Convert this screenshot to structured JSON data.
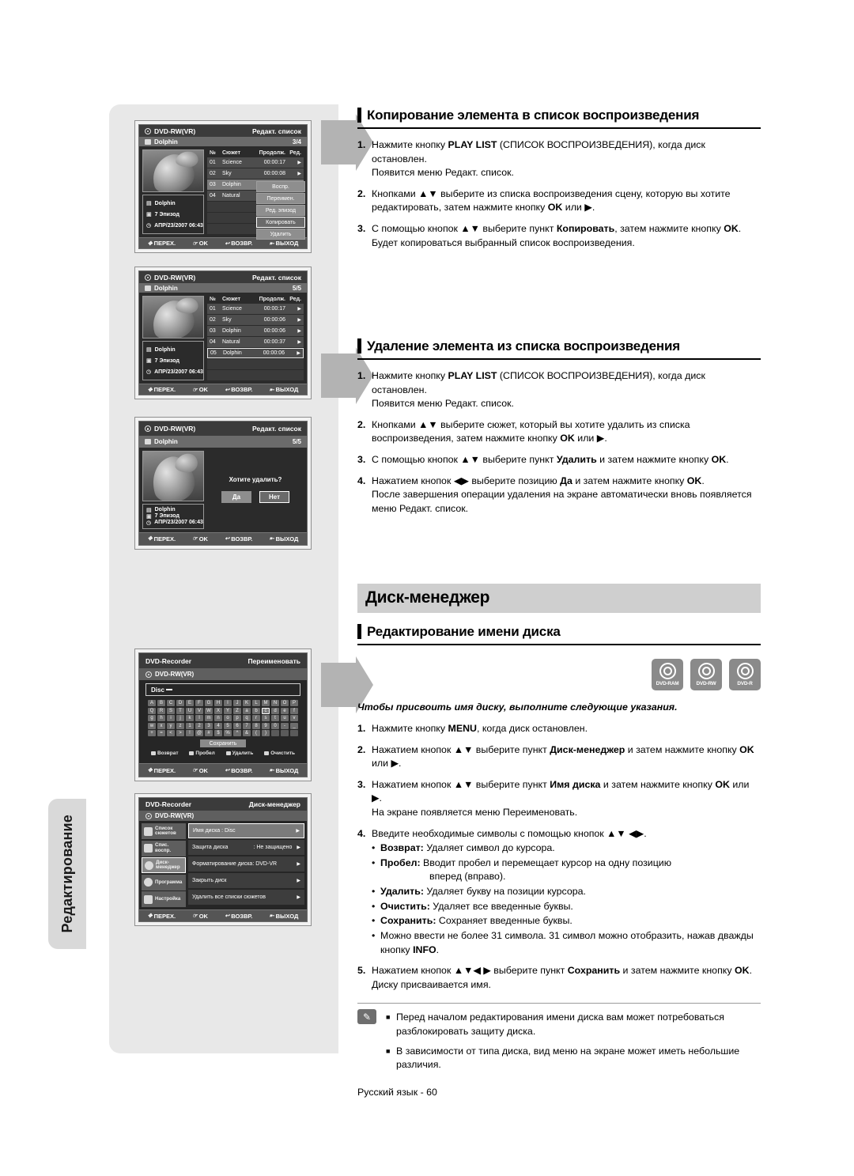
{
  "side_tab": {
    "label": "Редактирование"
  },
  "sections": {
    "copy": {
      "heading": "Копирование элемента в список воспроизведения",
      "steps": [
        {
          "num": "1.",
          "parts": [
            {
              "t": "Нажмите кнопку "
            },
            {
              "t": "PLAY LIST",
              "b": true
            },
            {
              "t": " (СПИСОК ВОСПРОИЗВЕДЕНИЯ), когда диск остановлен."
            },
            {
              "br": true
            },
            {
              "t": "Появится меню Редакт. список."
            }
          ]
        },
        {
          "num": "2.",
          "parts": [
            {
              "t": "Кнопками ▲▼ выберите из списка воспроизведения сцену, которую вы хотите редактировать, затем нажмите кнопку "
            },
            {
              "t": "OK",
              "b": true
            },
            {
              "t": " или ▶."
            }
          ]
        },
        {
          "num": "3.",
          "parts": [
            {
              "t": "С помощью кнопок ▲▼ выберите пункт "
            },
            {
              "t": "Копировать",
              "b": true
            },
            {
              "t": ", затем нажмите кнопку "
            },
            {
              "t": "OK",
              "b": true
            },
            {
              "t": "."
            },
            {
              "br": true
            },
            {
              "t": "Будет копироваться выбранный список воспроизведения."
            }
          ]
        }
      ]
    },
    "delete": {
      "heading": "Удаление элемента из списка воспроизведения",
      "steps": [
        {
          "num": "1.",
          "parts": [
            {
              "t": "Нажмите кнопку "
            },
            {
              "t": "PLAY LIST",
              "b": true
            },
            {
              "t": " (СПИСОК ВОСПРОИЗВЕДЕНИЯ), когда диск остановлен."
            },
            {
              "br": true
            },
            {
              "t": "Появится меню Редакт. список."
            }
          ]
        },
        {
          "num": "2.",
          "parts": [
            {
              "t": "Кнопками ▲▼ выберите сюжет, который вы хотите удалить из списка воспроизведения, затем нажмите кнопку "
            },
            {
              "t": "OK",
              "b": true
            },
            {
              "t": " или ▶."
            }
          ]
        },
        {
          "num": "3.",
          "parts": [
            {
              "t": "С помощью кнопок ▲▼ выберите пункт "
            },
            {
              "t": "Удалить",
              "b": true
            },
            {
              "t": " и затем нажмите кнопку "
            },
            {
              "t": "OK",
              "b": true
            },
            {
              "t": "."
            }
          ]
        },
        {
          "num": "4.",
          "parts": [
            {
              "t": "Нажатием кнопок ◀▶ выберите позицию "
            },
            {
              "t": "Да",
              "b": true
            },
            {
              "t": " и затем нажмите кнопку "
            },
            {
              "t": "OK",
              "b": true
            },
            {
              "t": "."
            },
            {
              "br": true
            },
            {
              "t": "После завершения операции удаления на экране автоматически вновь появляется меню Редакт. список."
            }
          ]
        }
      ]
    },
    "disc_manager": {
      "chapter_title": "Диск-менеджер",
      "heading": "Редактирование имени диска",
      "disc_marks": [
        "DVD-RAM",
        "DVD-RW",
        "DVD-R"
      ],
      "intro": "Чтобы присвоить имя диску, выполните следующие указания.",
      "steps": [
        {
          "num": "1.",
          "parts": [
            {
              "t": "Нажмите кнопку "
            },
            {
              "t": "MENU",
              "b": true
            },
            {
              "t": ", когда диск остановлен."
            }
          ]
        },
        {
          "num": "2.",
          "parts": [
            {
              "t": "Нажатием кнопок ▲▼ выберите пункт "
            },
            {
              "t": "Диск-менеджер",
              "b": true
            },
            {
              "t": " и затем нажмите кнопку "
            },
            {
              "t": "OK",
              "b": true
            },
            {
              "t": " или ▶."
            }
          ]
        },
        {
          "num": "3.",
          "parts": [
            {
              "t": "Нажатием кнопок ▲▼ выберите пункт "
            },
            {
              "t": "Имя диска",
              "b": true
            },
            {
              "t": " и затем нажмите кнопку "
            },
            {
              "t": "OK",
              "b": true
            },
            {
              "t": " или ▶."
            },
            {
              "br": true
            },
            {
              "t": "На экране появляется меню Переименовать."
            }
          ]
        },
        {
          "num": "4.",
          "parts": [
            {
              "t": "Введите необходимые символы с помощью кнопок ▲▼ ◀▶."
            }
          ],
          "sub": [
            {
              "bullet": "•",
              "parts": [
                {
                  "t": "Возврат:",
                  "b": true
                },
                {
                  "t": " Удаляет символ до курсора."
                }
              ]
            },
            {
              "bullet": "•",
              "parts": [
                {
                  "t": "Пробел:",
                  "b": true
                },
                {
                  "t": " Вводит пробел и перемещает курсор на одну позицию"
                },
                {
                  "hang": "вперед (вправо)."
                }
              ]
            },
            {
              "bullet": "•",
              "parts": [
                {
                  "t": "Удалить:",
                  "b": true
                },
                {
                  "t": " Удаляет букву на позиции курсора."
                }
              ]
            },
            {
              "bullet": "•",
              "parts": [
                {
                  "t": "Очистить:",
                  "b": true
                },
                {
                  "t": " Удаляет все введенные буквы."
                }
              ]
            },
            {
              "bullet": "•",
              "parts": [
                {
                  "t": "Сохранить:",
                  "b": true
                },
                {
                  "t": " Сохраняет введенные буквы."
                }
              ]
            },
            {
              "bullet": "•",
              "parts": [
                {
                  "t": "Можно ввести не более 31 символа. 31 символ можно отобразить, нажав дважды кнопку "
                },
                {
                  "t": "INFO",
                  "b": true
                },
                {
                  "t": "."
                }
              ]
            }
          ]
        },
        {
          "num": "5.",
          "parts": [
            {
              "t": "Нажатием кнопок ▲▼◀ ▶ выберите пункт "
            },
            {
              "t": "Сохранить",
              "b": true
            },
            {
              "t": " и затем нажмите кнопку "
            },
            {
              "t": "OK",
              "b": true
            },
            {
              "t": "."
            },
            {
              "br": true
            },
            {
              "t": "Диску присваивается имя."
            }
          ]
        }
      ],
      "notes": [
        "Перед началом редактирования имени диска вам может потребоваться разблокировать защиту диска.",
        "В зависимости от типа диска, вид меню на экране может иметь небольшие различия."
      ]
    }
  },
  "footer": {
    "page": "Русский язык - 60"
  },
  "screenshots": {
    "common_footer": [
      {
        "icon": "navpad-icon",
        "label": "ПЕРЕХ."
      },
      {
        "icon": "ok-icon",
        "label": "OK"
      },
      {
        "icon": "return-icon",
        "label": "ВОЗВР."
      },
      {
        "icon": "exit-icon",
        "label": "ВЫХОД"
      }
    ],
    "shot1": {
      "disc_type": "DVD-RW(VR)",
      "mode": "Редакт. список",
      "title": "Dolphin",
      "counter": "3/4",
      "columns": [
        "№",
        "Сюжет",
        "Продолж.",
        "Ред."
      ],
      "rows": [
        {
          "n": "01",
          "name": "Science",
          "dur": "00:00:17",
          "arrow": "▶"
        },
        {
          "n": "02",
          "name": "Sky",
          "dur": "00:00:08",
          "arrow": "▶"
        },
        {
          "n": "03",
          "name": "Dolphin",
          "dur": "",
          "arrow": ""
        },
        {
          "n": "04",
          "name": "Natural",
          "dur": "",
          "arrow": ""
        }
      ],
      "selected_row": 2,
      "info": {
        "name": "Dolphin",
        "episode": "7 Эпизод",
        "date": "АПР/23/2007 06:43"
      },
      "context_menu": [
        "Воспр.",
        "Переимен.",
        "Ред. эпизод",
        "Копировать",
        "Удалить"
      ],
      "context_selected": "Копировать"
    },
    "shot2": {
      "disc_type": "DVD-RW(VR)",
      "mode": "Редакт. список",
      "title": "Dolphin",
      "counter": "5/5",
      "columns": [
        "№",
        "Сюжет",
        "Продолж.",
        "Ред."
      ],
      "rows": [
        {
          "n": "01",
          "name": "Science",
          "dur": "00:00:17",
          "arrow": "▶"
        },
        {
          "n": "02",
          "name": "Sky",
          "dur": "00:00:06",
          "arrow": "▶"
        },
        {
          "n": "03",
          "name": "Dolphin",
          "dur": "00:00:06",
          "arrow": "▶"
        },
        {
          "n": "04",
          "name": "Natural",
          "dur": "00:00:37",
          "arrow": "▶"
        },
        {
          "n": "05",
          "name": "Dolphin",
          "dur": "00:00:06",
          "arrow": "▶"
        }
      ],
      "selected_row": 4,
      "info": {
        "name": "Dolphin",
        "episode": "7 Эпизод",
        "date": "АПР/23/2007 06:43"
      }
    },
    "shot3": {
      "disc_type": "DVD-RW(VR)",
      "mode": "Редакт. список",
      "title": "Dolphin",
      "counter": "5/5",
      "question": "Хотите удалить?",
      "buttons": [
        "Да",
        "Нет"
      ],
      "selected_button": "Да",
      "info": {
        "name": "Dolphin",
        "episode": "7 Эпизод",
        "date": "АПР/23/2007 06:43"
      }
    },
    "shot4": {
      "device": "DVD-Recorder",
      "mode": "Переименовать",
      "disc_type": "DVD-RW(VR)",
      "input_value": "Disc",
      "keyboard_rows": [
        [
          "A",
          "B",
          "C",
          "D",
          "E",
          "F",
          "G",
          "H",
          "I",
          "J",
          "K",
          "L",
          "M",
          "N",
          "O",
          "P"
        ],
        [
          "Q",
          "R",
          "S",
          "T",
          "U",
          "V",
          "W",
          "X",
          "Y",
          "Z",
          "a",
          "b",
          "c",
          "d",
          "e",
          "f"
        ],
        [
          "g",
          "h",
          "i",
          "j",
          "k",
          "l",
          "m",
          "n",
          "o",
          "p",
          "q",
          "r",
          "s",
          "t",
          "u",
          "v"
        ],
        [
          "w",
          "x",
          "y",
          "z",
          "1",
          "2",
          "3",
          "4",
          "5",
          "6",
          "7",
          "8",
          "9",
          "0",
          "-",
          "_"
        ],
        [
          "+",
          "=",
          "<",
          ">",
          "!",
          "@",
          "#",
          "$",
          "%",
          "^",
          "&",
          "(",
          ")",
          "",
          "",
          ""
        ]
      ],
      "selected_key": "c",
      "save_label": "Сохранить",
      "legend": [
        "Возврат",
        "Пробел",
        "Удалить",
        "Очистить"
      ]
    },
    "shot5": {
      "device": "DVD-Recorder",
      "mode": "Диск-менеджер",
      "disc_type": "DVD-RW(VR)",
      "sidebar": [
        {
          "icon": "film-icon",
          "label": "Список сюжетов"
        },
        {
          "icon": "playlist-icon",
          "label": "Спис. воспр."
        },
        {
          "icon": "disc-icon",
          "label": "Диск-менеджер"
        },
        {
          "icon": "program-icon",
          "label": "Программа"
        },
        {
          "icon": "gear-icon",
          "label": "Настройка"
        }
      ],
      "sidebar_selected": 2,
      "menu": [
        {
          "label": "Имя диска : Disc",
          "arrow": "▶"
        },
        {
          "label": "Защита диска",
          "value": ": Не защищено",
          "arrow": "▶"
        },
        {
          "label": "Форматирование диска: DVD-VR",
          "arrow": "▶"
        },
        {
          "label": "Закрыть диск",
          "arrow": "▶"
        },
        {
          "label": "Удалить все списки сюжетов",
          "arrow": "▶"
        }
      ],
      "menu_selected": 0
    }
  }
}
